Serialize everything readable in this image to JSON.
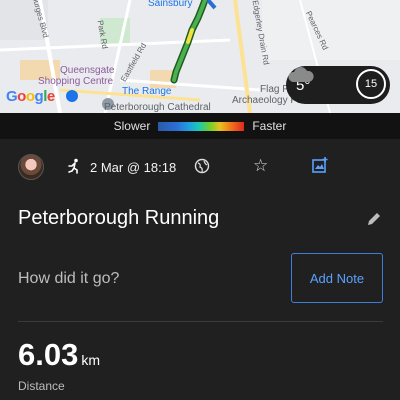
{
  "map": {
    "labels": {
      "sainsbury": "Sainsbury",
      "queensgate": "Queensgate",
      "shopping_centre": "Shopping Centre",
      "the_range": "The Range",
      "cathedral": "Peterborough Cathedral",
      "flag_fen": "Flag F",
      "archaeology": "Archaeology Pa",
      "eastfield_rd": "Eastfield Rd",
      "edgerley_drain_rd": "Edgerley Drain Rd",
      "pearces_rd": "Pearces Rd",
      "park_rd": "Park Rd",
      "bourges_blvd": "Bourges Blvd"
    },
    "google_logo": "Google"
  },
  "weather": {
    "temperature": "5°",
    "condition_icon": "cloud-icon",
    "speed_limit": "15"
  },
  "legend": {
    "slower": "Slower",
    "faster": "Faster"
  },
  "activity": {
    "type_icon": "running-icon",
    "date": "2 Mar @ 18:18",
    "title": "Peterborough Running",
    "prompt": "How did it go?",
    "add_note_label": "Add Note",
    "distance_value": "6.03",
    "distance_unit": "km",
    "distance_label": "Distance"
  }
}
